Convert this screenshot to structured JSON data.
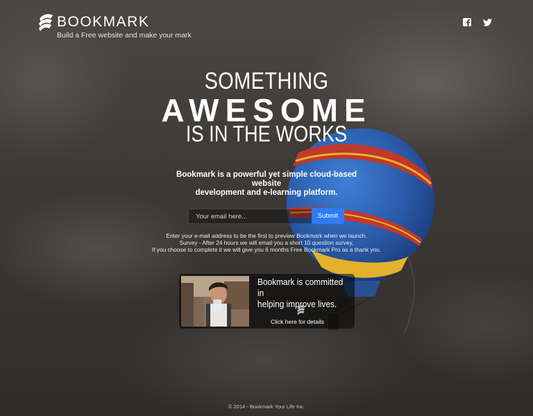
{
  "brand": {
    "name": "BOOKMARK",
    "tagline": "Build a Free website and make your mark"
  },
  "social": {
    "facebook_icon": "facebook-icon",
    "twitter_icon": "twitter-icon"
  },
  "hero": {
    "line1": "SOMETHING",
    "line2": "AWESOME",
    "line3": "IS IN THE WORKS",
    "description_line1": "Bookmark is a powerful yet simple cloud-based website",
    "description_line2": "development and e-learning platform."
  },
  "signup": {
    "email_placeholder": "Your email here...",
    "submit_label": "Submit",
    "info_line1": "Enter your e-mail address to be the first to preview Bookmark when we launch.",
    "info_line2": "Survey - After 24 hours we will email you a short 10 question survey,",
    "info_line3": "If you choose to complete it we will give you 6 months Free Bookmark Pro as a thank you."
  },
  "charity_card": {
    "title_line1": "Bookmark is committed in",
    "title_line2": "helping improve lives.",
    "cta": "Click here for details"
  },
  "footer": {
    "copyright": "© 2014 - Bookmark Your Life Inc."
  },
  "colors": {
    "accent": "#2e7bf5",
    "background": "#3f3c39"
  }
}
